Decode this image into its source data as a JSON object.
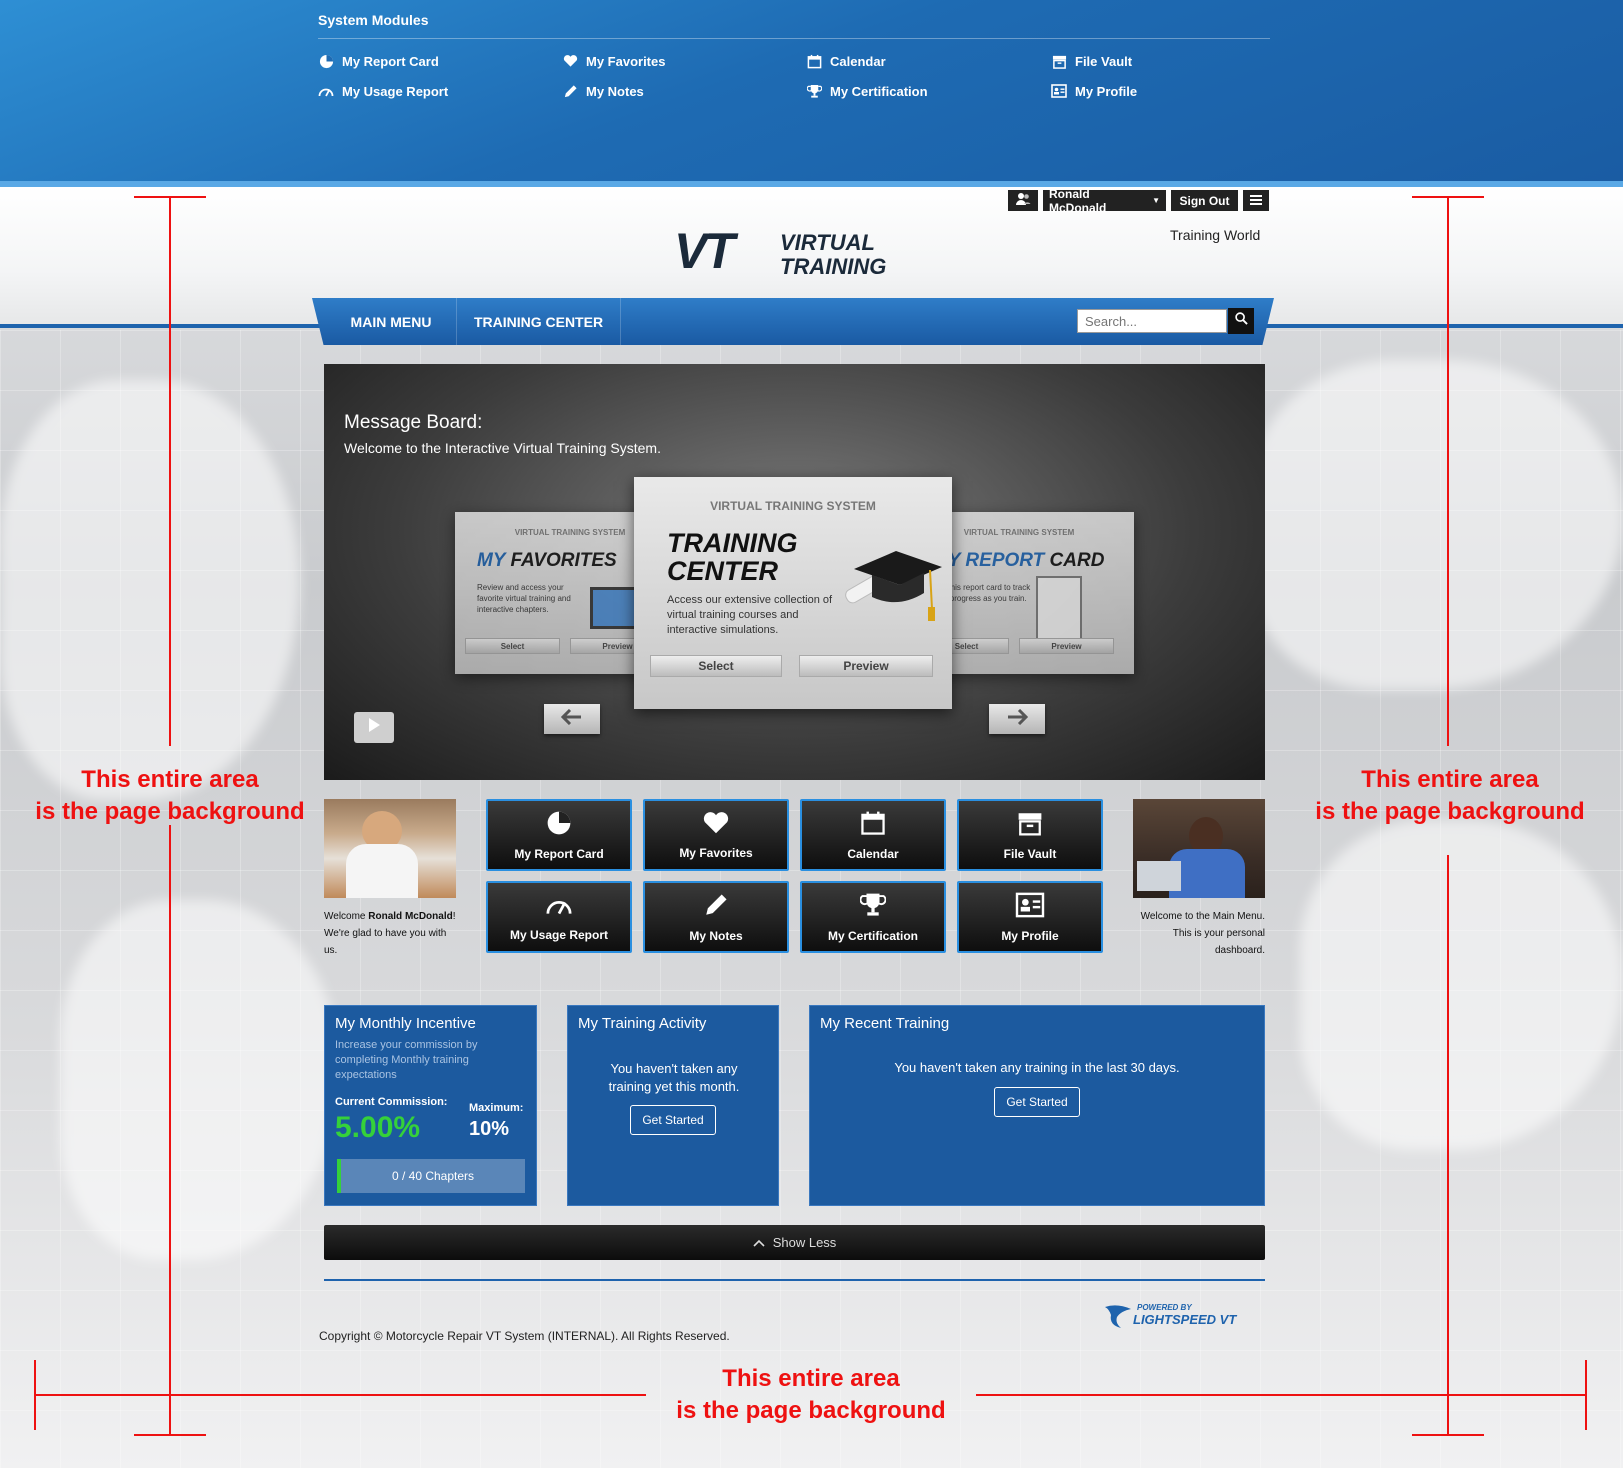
{
  "system_modules": {
    "title": "System Modules",
    "items": [
      {
        "label": "My Report Card",
        "icon": "pie-chart-icon"
      },
      {
        "label": "My Favorites",
        "icon": "heart-icon"
      },
      {
        "label": "Calendar",
        "icon": "calendar-icon"
      },
      {
        "label": "File Vault",
        "icon": "archive-icon"
      },
      {
        "label": "My Usage Report",
        "icon": "gauge-icon"
      },
      {
        "label": "My Notes",
        "icon": "pencil-icon"
      },
      {
        "label": "My Certification",
        "icon": "trophy-icon"
      },
      {
        "label": "My Profile",
        "icon": "id-card-icon"
      }
    ]
  },
  "header": {
    "user_name": "Ronald McDonald",
    "sign_out": "Sign Out",
    "site_name": "Training World",
    "logo_mark": "VT",
    "logo_line1": "VIRTUAL",
    "logo_line2": "TRAINING"
  },
  "nav": {
    "items": [
      "MAIN MENU",
      "TRAINING CENTER"
    ],
    "search_placeholder": "Search..."
  },
  "message_board": {
    "title": "Message Board:",
    "subtitle": "Welcome to the Interactive Virtual Training System.",
    "cards": [
      {
        "kicker": "VIRTUAL TRAINING SYSTEM",
        "title_a": "MY",
        "title_b": "FAVORITES",
        "desc": "Review and access your favorite virtual training and interactive chapters.",
        "select": "Select",
        "preview": "Preview"
      },
      {
        "kicker": "VIRTUAL TRAINING SYSTEM",
        "title_a": "TRAINING",
        "title_b": "CENTER",
        "desc": "Access our extensive collection of virtual training courses and interactive simulations.",
        "select": "Select",
        "preview": "Preview"
      },
      {
        "kicker": "VIRTUAL TRAINING SYSTEM",
        "title_a": "MY REPORT",
        "title_b": "CARD",
        "desc": "Use this report card to track your progress as you train.",
        "select": "Select",
        "preview": "Preview"
      }
    ]
  },
  "welcome_left": {
    "prefix": "Welcome ",
    "name": "Ronald McDonald",
    "suffix": "!",
    "line2": "We're glad to have you with us."
  },
  "welcome_right": {
    "text": "Welcome to the Main Menu. This is your personal dashboard."
  },
  "tiles": [
    {
      "label": "My Report Card",
      "icon": "pie-chart-icon"
    },
    {
      "label": "My Favorites",
      "icon": "heart-icon"
    },
    {
      "label": "Calendar",
      "icon": "calendar-icon"
    },
    {
      "label": "File Vault",
      "icon": "archive-icon"
    },
    {
      "label": "My Usage Report",
      "icon": "gauge-icon"
    },
    {
      "label": "My Notes",
      "icon": "pencil-icon"
    },
    {
      "label": "My Certification",
      "icon": "trophy-icon"
    },
    {
      "label": "My Profile",
      "icon": "id-card-icon"
    }
  ],
  "incentive": {
    "title": "My Monthly Incentive",
    "desc": "Increase your commission by completing Monthly training expectations",
    "current_label": "Current Commission:",
    "current_value": "5.00%",
    "max_label": "Maximum:",
    "max_value": "10%",
    "progress_text": "0 / 40 Chapters",
    "progress_fraction": 0
  },
  "activity": {
    "title": "My Training Activity",
    "message": "You haven't taken any training yet this month.",
    "button": "Get Started"
  },
  "recent": {
    "title": "My Recent Training",
    "message": "You haven't taken any training in the last 30 days.",
    "button": "Get Started"
  },
  "show_less": "Show Less",
  "footer": {
    "copyright": "Copyright © Motorcycle Repair VT System (INTERNAL). All Rights Reserved.",
    "powered_by": "POWERED BY",
    "brand": "LIGHTSPEED VT"
  },
  "annotations": {
    "left": [
      "This entire area",
      "is the page background"
    ],
    "right": [
      "This entire area",
      "is the page background"
    ],
    "bottom": [
      "This entire area",
      "is the page background"
    ]
  },
  "colors": {
    "brand_blue": "#1e63ad",
    "panel_blue": "#1c5a9f",
    "tile_border": "#2a8fe0",
    "commission_green": "#35d13a",
    "annotation_red": "#ee1111"
  }
}
